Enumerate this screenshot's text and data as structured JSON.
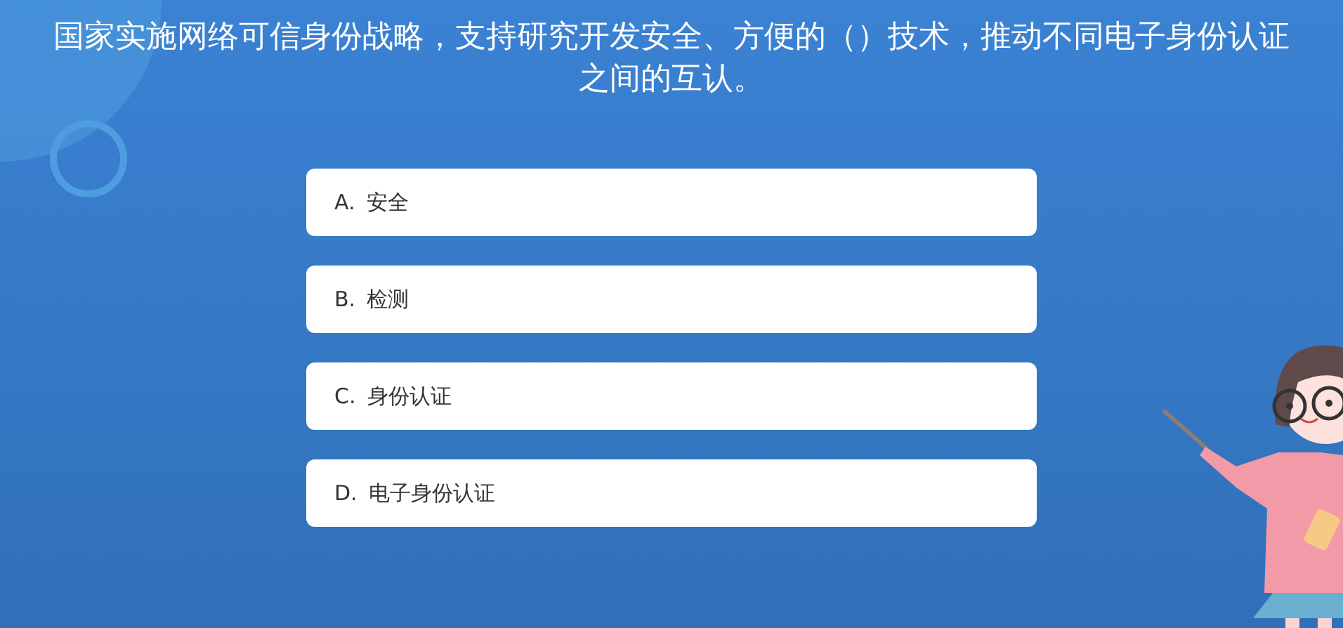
{
  "question": {
    "text": "国家实施网络可信身份战略，支持研究开发安全、方便的（）技术，推动不同电子身份认证之间的互认。"
  },
  "options": [
    {
      "letter": "A.",
      "text": "安全"
    },
    {
      "letter": "B.",
      "text": "检测"
    },
    {
      "letter": "C.",
      "text": "身份认证"
    },
    {
      "letter": "D.",
      "text": "电子身份认证"
    }
  ]
}
